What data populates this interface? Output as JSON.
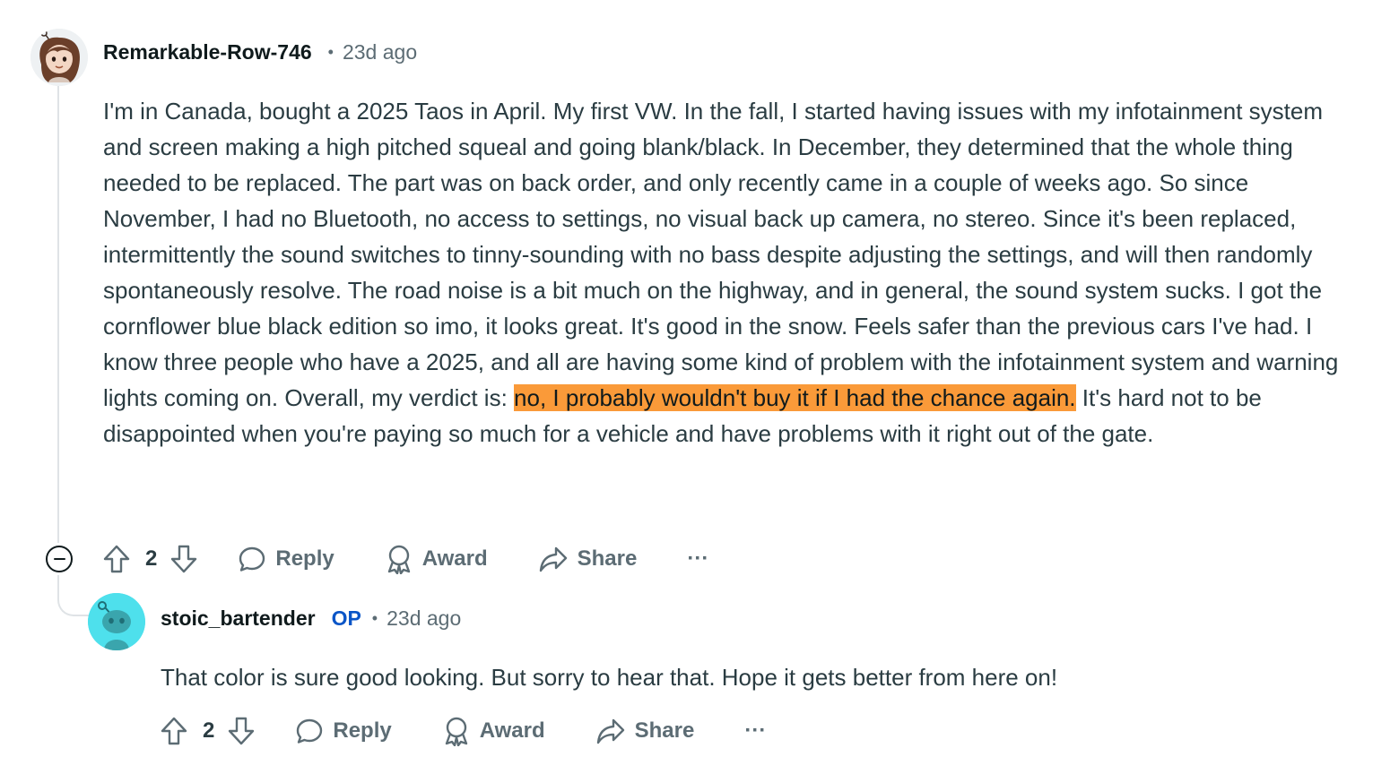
{
  "comment": {
    "username": "Remarkable-Row-746",
    "separator": "•",
    "timestamp": "23d ago",
    "body_before": "I'm in Canada, bought a 2025 Taos in April. My first VW. In the fall, I started having issues with my infotainment system and screen making a high pitched squeal and going blank/black. In December, they determined that the whole thing needed to be replaced. The part was on back order, and only recently came in a couple of weeks ago. So since November, I had no Bluetooth, no access to settings, no visual back up camera, no stereo. Since it's been replaced, intermittently the sound switches to tinny-sounding with no bass despite adjusting the settings, and will then randomly spontaneously resolve. The road noise is a bit much on the highway, and in general, the sound system sucks. I got the cornflower blue black edition so imo, it looks great. It's good in the snow. Feels safer than the previous cars I've had. I know three people who have a 2025, and all are having some kind of problem with the infotainment system and warning lights coming on. Overall, my verdict is: ",
    "body_highlight": "no, I probably wouldn't buy it if I had the chance again.",
    "body_after": " It's hard not to be disappointed when you're paying so much for a vehicle and have problems with it right out of the gate.",
    "highlight_color": "#fa9a39",
    "votes": "2",
    "reply_label": "Reply",
    "award_label": "Award",
    "share_label": "Share",
    "more_label": "···",
    "avatar_icon": "user-avatar-girl-icon"
  },
  "reply": {
    "username": "stoic_bartender",
    "op_badge": "OP",
    "op_color": "#0a55c7",
    "separator": "•",
    "timestamp": "23d ago",
    "body": "That color is sure good looking. But sorry to hear that. Hope it gets better from here on!",
    "votes": "2",
    "reply_label": "Reply",
    "award_label": "Award",
    "share_label": "Share",
    "more_label": "···",
    "avatar_icon": "snoo-avatar-icon",
    "avatar_color": "#4ee0ec"
  },
  "colors": {
    "text": "#2a3c42",
    "meta": "#5c6c74",
    "thread_line": "#dfe3e6"
  }
}
